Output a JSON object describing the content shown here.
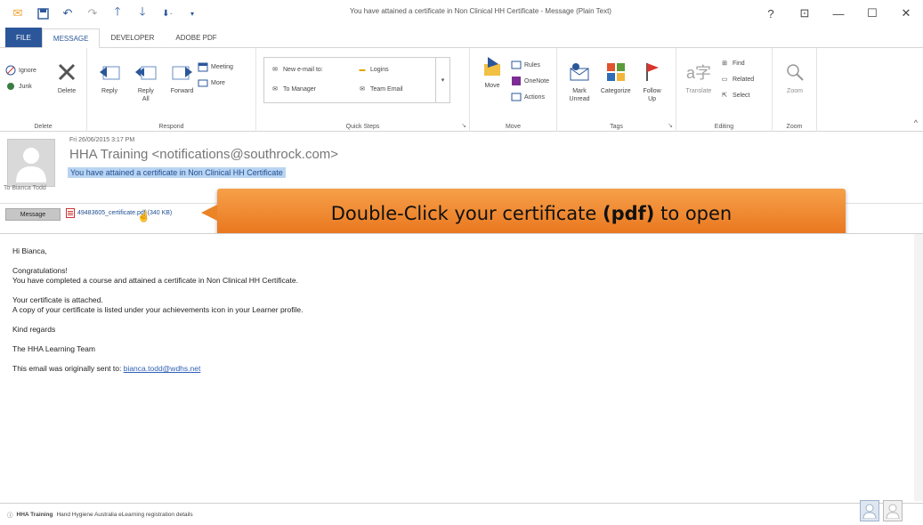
{
  "window": {
    "title": "You have attained a certificate in Non Clinical HH Certificate - Message (Plain Text)",
    "help": "?",
    "restore": "⊡",
    "minimize": "—",
    "maximize": "☐",
    "close": "✕"
  },
  "tabs": [
    "FILE",
    "MESSAGE",
    "DEVELOPER",
    "ADOBE PDF"
  ],
  "ribbon": {
    "delete_group": {
      "label": "Delete",
      "ignore": "Ignore",
      "junk": "Junk",
      "delete": "Delete"
    },
    "respond_group": {
      "label": "Respond",
      "reply": "Reply",
      "reply_all": "Reply All",
      "forward": "Forward",
      "meeting": "Meeting",
      "more": "More"
    },
    "quick_steps_group": {
      "label": "Quick Steps",
      "items": [
        "New e-mail to:",
        "Logins",
        "To Manager",
        "Team Email"
      ]
    },
    "move_group": {
      "label": "Move",
      "move": "Move",
      "rules": "Rules",
      "onenote": "OneNote",
      "actions": "Actions"
    },
    "tags_group": {
      "label": "Tags",
      "mark_unread": "Mark Unread",
      "categorize": "Categorize",
      "follow_up": "Follow Up"
    },
    "editing_group": {
      "label": "Editing",
      "translate": "Translate",
      "find": "Find",
      "related": "Related",
      "select": "Select"
    },
    "zoom_group": {
      "label": "Zoom",
      "zoom": "Zoom"
    }
  },
  "message": {
    "date": "Fri 26/06/2015 3:17 PM",
    "from": "HHA Training <notifications@southrock.com>",
    "subject": "You have attained a certificate in Non Clinical HH Certificate",
    "to": "To   Bianca Todd",
    "message_tab": "Message",
    "attachment": "49483605_certificate.pdf (340 KB)"
  },
  "callout": {
    "before": "Double-Click your certificate ",
    "bold": "(pdf)",
    "after": " to open"
  },
  "body": {
    "greeting": "Hi Bianca,",
    "line1": "Congratulations!",
    "line2": "You have completed a course and attained a certificate in Non Clinical HH Certificate.",
    "line3": "Your certificate is attached.",
    "line4": "A copy of your certificate is listed under your achievements icon in your Learner profile.",
    "line5": "Kind regards",
    "line6": "The HHA Learning Team",
    "line7": "This email was originally sent to: ",
    "email_link": "bianca.todd@wdhs.net"
  },
  "people_pane": {
    "name": "HHA Training",
    "text": "Hand Hygiene Australia eLearning registration details"
  },
  "colors": {
    "accent": "#2b579a",
    "callout": "#ef8a2e",
    "highlight": "#b9d4f2"
  }
}
